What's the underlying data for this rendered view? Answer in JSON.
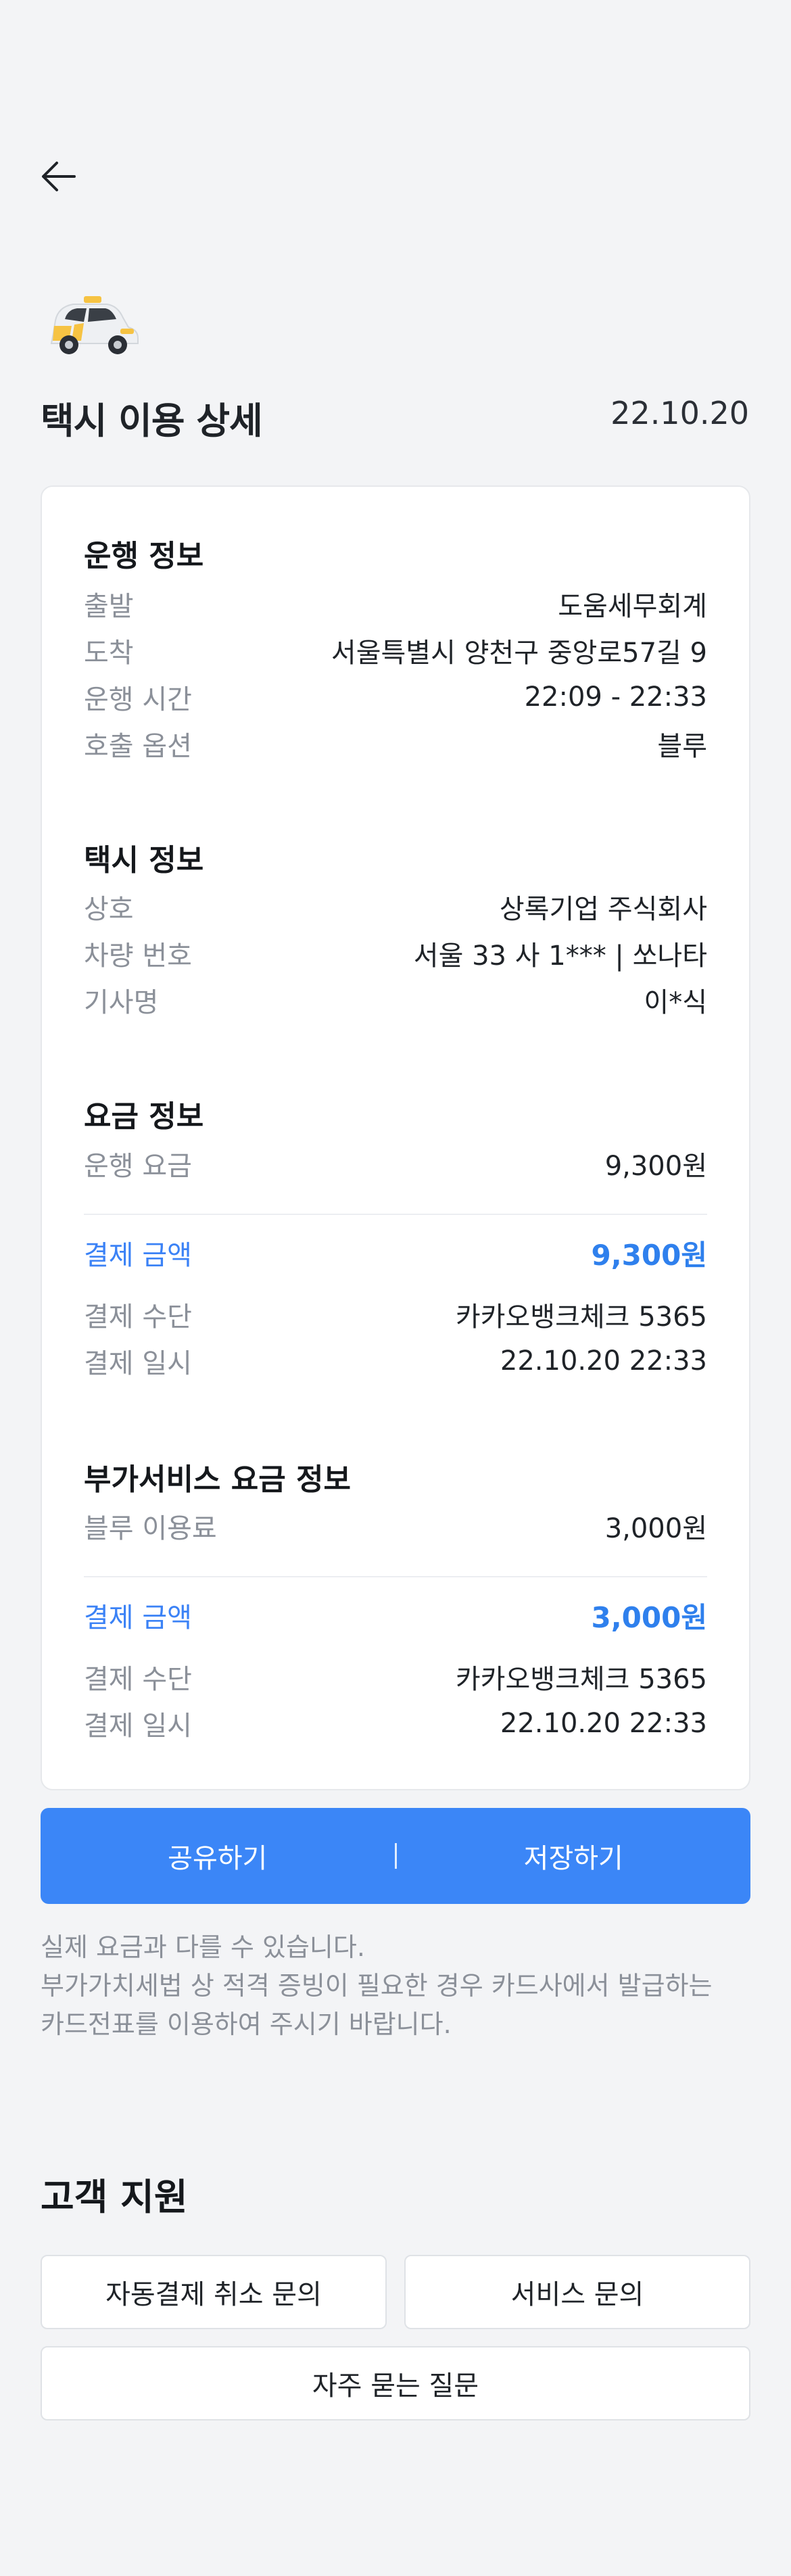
{
  "header": {
    "back_icon": "arrow-left-icon",
    "taxi_icon": "taxi-car-icon",
    "title": "택시 이용 상세",
    "date": "22.10.20"
  },
  "colors": {
    "accent": "#3b86f7",
    "pay_text": "#2f80ed",
    "muted": "#8b9099",
    "background": "#f3f4f6"
  },
  "trip": {
    "title": "운행 정보",
    "rows": [
      {
        "label": "출발",
        "value": "도움세무회계"
      },
      {
        "label": "도착",
        "value": "서울특별시 양천구 중앙로57길 9"
      },
      {
        "label": "운행 시간",
        "value": "22:09 - 22:33"
      },
      {
        "label": "호출 옵션",
        "value": "블루"
      }
    ]
  },
  "taxi": {
    "title": "택시 정보",
    "rows": [
      {
        "label": "상호",
        "value": "상록기업 주식회사"
      },
      {
        "label": "차량 번호",
        "value": "서울 33 사 1*** | 쏘나타"
      },
      {
        "label": "기사명",
        "value": "이*식"
      }
    ]
  },
  "fare": {
    "title": "요금 정보",
    "fare_row": {
      "label": "운행 요금",
      "value": "9,300원"
    },
    "pay_row": {
      "label": "결제 금액",
      "value": "9,300원"
    },
    "rows": [
      {
        "label": "결제 수단",
        "value": "카카오뱅크체크 5365"
      },
      {
        "label": "결제 일시",
        "value": "22.10.20 22:33"
      }
    ]
  },
  "addon": {
    "title": "부가서비스 요금 정보",
    "fare_row": {
      "label": "블루 이용료",
      "value": "3,000원"
    },
    "pay_row": {
      "label": "결제 금액",
      "value": "3,000원"
    },
    "rows": [
      {
        "label": "결제 수단",
        "value": "카카오뱅크체크 5365"
      },
      {
        "label": "결제 일시",
        "value": "22.10.20 22:33"
      }
    ]
  },
  "actions": {
    "share": "공유하기",
    "separator": "|",
    "save": "저장하기"
  },
  "notice": {
    "line1": "실제 요금과 다를 수 있습니다.",
    "line2": "부가가치세법 상 적격 증빙이 필요한 경우 카드사에서 발급하는",
    "line3": "카드전표를 이용하여 주시기 바랍니다."
  },
  "support": {
    "title": "고객 지원",
    "auto_payment_cancel": "자동결제 취소 문의",
    "service_inquiry": "서비스 문의",
    "faq": "자주 묻는 질문"
  }
}
